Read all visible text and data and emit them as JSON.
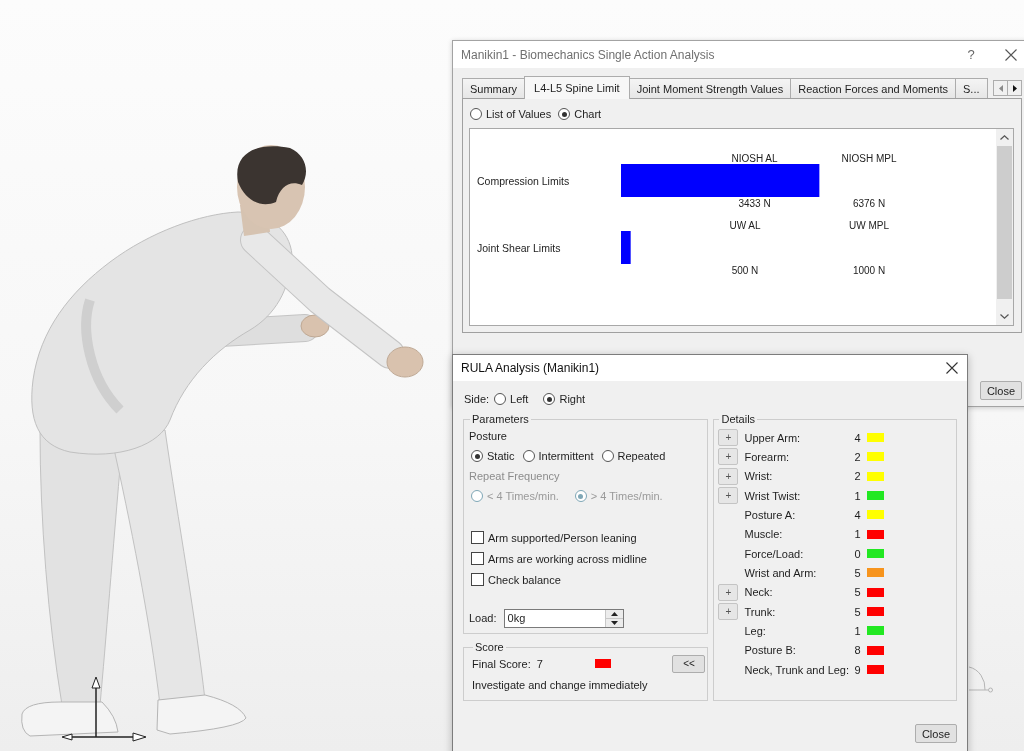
{
  "analysis_window": {
    "title": "Manikin1 - Biomechanics Single Action Analysis",
    "help": "?",
    "tabs": [
      {
        "label": "Summary",
        "selected": false
      },
      {
        "label": "L4-L5 Spine Limit",
        "selected": true
      },
      {
        "label": "Joint Moment Strength Values",
        "selected": false
      },
      {
        "label": "Reaction Forces and Moments",
        "selected": false
      },
      {
        "label": "S...",
        "selected": false
      }
    ],
    "view_options": [
      {
        "label": "List of Values",
        "selected": false
      },
      {
        "label": "Chart",
        "selected": true
      }
    ],
    "limit_rows": [
      {
        "chart_data": {
          "type": "bar",
          "orientation": "horizontal",
          "categories": [
            "Compression Limits"
          ],
          "values": [
            5100
          ],
          "xlim": [
            0,
            6376
          ],
          "xticks": [
            {
              "value": 3433,
              "label": "3433 N"
            },
            {
              "value": 6376,
              "label": "6376 N"
            }
          ],
          "annotations": [
            "NIOSH AL",
            "NIOSH MPL"
          ]
        }
      },
      {
        "chart_data": {
          "type": "bar",
          "orientation": "horizontal",
          "categories": [
            "Joint Shear Limits"
          ],
          "values": [
            39
          ],
          "xlim": [
            0,
            1000
          ],
          "xticks": [
            {
              "value": 500,
              "label": "500 N"
            },
            {
              "value": 1000,
              "label": "1000 N"
            }
          ],
          "annotations": [
            "UW AL",
            "UW MPL"
          ]
        }
      }
    ],
    "close_button": "Close"
  },
  "rula_window": {
    "title": "RULA Analysis (Manikin1)",
    "side": {
      "label": "Side:",
      "options": [
        {
          "label": "Left",
          "selected": false
        },
        {
          "label": "Right",
          "selected": true
        }
      ]
    },
    "parameters": {
      "legend": "Parameters",
      "posture_label": "Posture",
      "posture_options": [
        {
          "label": "Static",
          "selected": true
        },
        {
          "label": "Intermittent",
          "selected": false
        },
        {
          "label": "Repeated",
          "selected": false
        }
      ],
      "repeat_frequency": {
        "label": "Repeat Frequency",
        "disabled": true,
        "options": [
          {
            "label": "< 4 Times/min.",
            "selected": false
          },
          {
            "label": "> 4 Times/min.",
            "selected": true
          }
        ]
      },
      "checkboxes": [
        {
          "label": "Arm supported/Person leaning",
          "checked": false
        },
        {
          "label": "Arms are working across midline",
          "checked": false
        },
        {
          "label": "Check balance",
          "checked": false
        }
      ],
      "load": {
        "label": "Load:",
        "value": "0kg"
      }
    },
    "score": {
      "legend": "Score",
      "label": "Final Score:",
      "value": "7",
      "color": "#ff0000",
      "toggle_button": "<<",
      "verdict": "Investigate and change immediately"
    },
    "details": {
      "legend": "Details",
      "rows": [
        {
          "label": "Upper Arm:",
          "value": "4",
          "color": "#ffff00",
          "button": "+"
        },
        {
          "label": "Forearm:",
          "value": "2",
          "color": "#ffff00",
          "button": "+"
        },
        {
          "label": "Wrist:",
          "value": "2",
          "color": "#ffff00",
          "button": "+"
        },
        {
          "label": "Wrist Twist:",
          "value": "1",
          "color": "#22e822",
          "button": "+"
        },
        {
          "label": "Posture A:",
          "value": "4",
          "color": "#ffff00"
        },
        {
          "label": "Muscle:",
          "value": "1",
          "color": "#ff0000"
        },
        {
          "label": "Force/Load:",
          "value": "0",
          "color": "#22e822"
        },
        {
          "label": "Wrist and Arm:",
          "value": "5",
          "color": "#f7941d"
        },
        {
          "label": "Neck:",
          "value": "5",
          "color": "#ff0000",
          "button": "+"
        },
        {
          "label": "Trunk:",
          "value": "5",
          "color": "#ff0000",
          "button": "+"
        },
        {
          "label": "Leg:",
          "value": "1",
          "color": "#22e822"
        },
        {
          "label": "Posture B:",
          "value": "8",
          "color": "#ff0000"
        },
        {
          "label": "Neck, Trunk and Leg:",
          "value": "9",
          "color": "#ff0000"
        }
      ]
    },
    "close_button": "Close"
  }
}
